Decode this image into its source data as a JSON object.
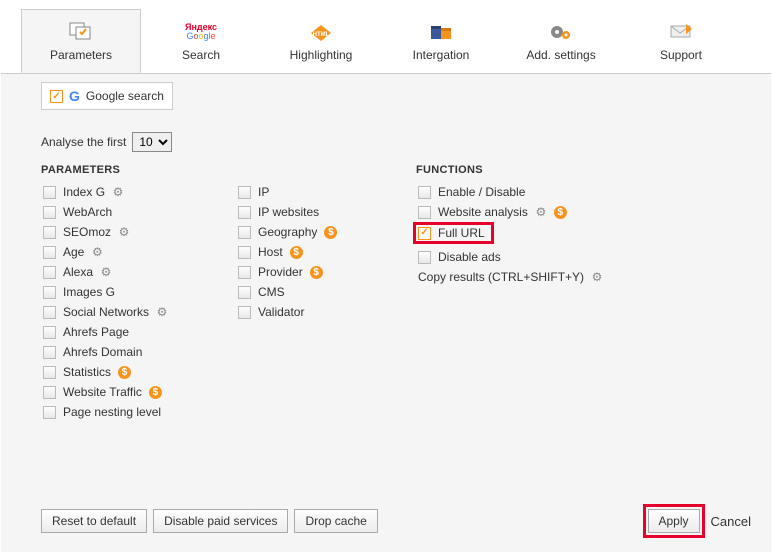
{
  "tabs": {
    "parameters": "Parameters",
    "search": "Search",
    "highlighting": "Highlighting",
    "integration": "Intergation",
    "add_settings": "Add. settings",
    "support": "Support"
  },
  "subtab": {
    "label": "Google search"
  },
  "analyse": {
    "label": "Analyse the first",
    "value": "10"
  },
  "headers": {
    "parameters": "PARAMETERS",
    "functions": "FUNCTIONS"
  },
  "col1": {
    "index_g": "Index G",
    "webarch": "WebArch",
    "seomoz": "SEOmoz",
    "age": "Age",
    "alexa": "Alexa",
    "images_g": "Images G",
    "social": "Social Networks",
    "ahrefs_page": "Ahrefs Page",
    "ahrefs_domain": "Ahrefs Domain",
    "statistics": "Statistics",
    "website_traffic": "Website Traffic",
    "nesting": "Page nesting level"
  },
  "col2": {
    "ip": "IP",
    "ip_websites": "IP websites",
    "geography": "Geography",
    "host": "Host",
    "provider": "Provider",
    "cms": "CMS",
    "validator": "Validator"
  },
  "col3": {
    "enable_disable": "Enable / Disable",
    "website_analysis": "Website analysis",
    "full_url": "Full URL",
    "disable_ads": "Disable ads",
    "copy_results": "Copy results (CTRL+SHIFT+Y)"
  },
  "footer": {
    "reset": "Reset to default",
    "disable_paid": "Disable paid services",
    "drop_cache": "Drop cache",
    "apply": "Apply",
    "cancel": "Cancel"
  }
}
